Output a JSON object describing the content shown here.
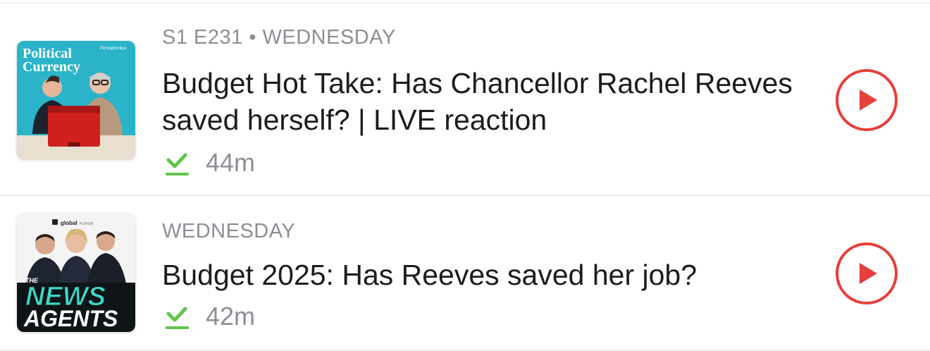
{
  "episodes": [
    {
      "show_art": {
        "show_title_line1": "Political",
        "show_title_line2": "Currency",
        "network": "Persephonica"
      },
      "meta": "S1 E231 • WEDNESDAY",
      "title": "Budget Hot Take: Has Chancellor Rachel Reeves saved herself? | LIVE reaction",
      "downloaded": true,
      "duration": "44m"
    },
    {
      "show_art": {
        "network": "global",
        "network_suffix": "PLAYER",
        "show_prefix": "THE",
        "show_title_line1": "NEWS",
        "show_title_line2": "AGENTS"
      },
      "meta": "WEDNESDAY",
      "title": "Budget 2025: Has Reeves saved her job?",
      "downloaded": true,
      "duration": "42m"
    }
  ],
  "colors": {
    "accent": "#e5403a",
    "download_check": "#62c54a",
    "meta_text": "#8e8e96",
    "title_text": "#1c1c1e",
    "political_currency_bg": "#2bb3c9",
    "news_agents_bg": "#0f1417",
    "news_agents_text": "#3ed8c8"
  },
  "icons": {
    "download": "checkmark-download-icon",
    "play": "play-circle-icon"
  }
}
